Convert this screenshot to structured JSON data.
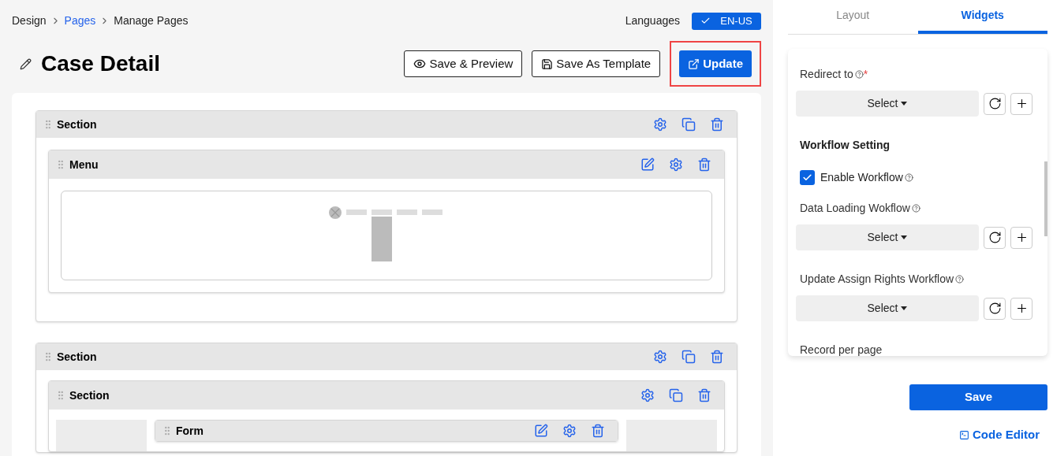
{
  "breadcrumb": [
    {
      "label": "Design",
      "link": false
    },
    {
      "label": "Pages",
      "link": true
    },
    {
      "label": "Manage Pages",
      "link": false
    }
  ],
  "languages": {
    "label": "Languages",
    "value": "EN-US"
  },
  "title": "Case Detail",
  "actions": [
    {
      "label": "Save & Preview",
      "kind": "preview",
      "highlighted": false
    },
    {
      "label": "Save As Template",
      "kind": "template",
      "highlighted": false
    },
    {
      "label": "Update",
      "kind": "update",
      "highlighted": true
    }
  ],
  "sections": [
    {
      "title": "Section",
      "children": [
        {
          "kind": "menu",
          "title": "Menu"
        }
      ]
    },
    {
      "title": "Section",
      "children": [
        {
          "kind": "section",
          "title": "Section",
          "children": [
            {
              "kind": "form",
              "title": "Form"
            }
          ]
        }
      ]
    }
  ],
  "tabs": [
    {
      "label": "Layout",
      "selected": false
    },
    {
      "label": "Widgets",
      "selected": true
    }
  ],
  "fields": [
    {
      "kind": "select",
      "label": "Redirect to",
      "help": true,
      "required_mark": "*",
      "value": "Select"
    },
    {
      "kind": "heading",
      "label": "Workflow Setting"
    },
    {
      "kind": "checkbox",
      "label": "Enable Workflow",
      "help": true,
      "checked": true
    },
    {
      "kind": "select",
      "label": "Data Loading Wokflow",
      "help": true,
      "value": "Select"
    },
    {
      "kind": "select",
      "label": "Update Assign Rights Workflow",
      "help": true,
      "value": "Select"
    },
    {
      "kind": "text",
      "label": "Record per page"
    }
  ],
  "save_button": "Save",
  "code_editor": "Code Editor"
}
